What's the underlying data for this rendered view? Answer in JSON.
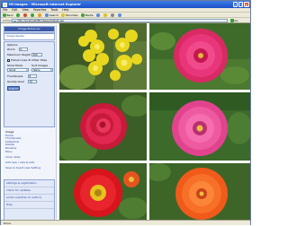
{
  "window": {
    "title": "IM Images - Microsoft Internet Explorer"
  },
  "menubar": {
    "items": [
      "File",
      "Edit",
      "View",
      "Favorites",
      "Tools",
      "Help"
    ]
  },
  "toolbar": {
    "items": [
      {
        "label": "Back",
        "icon": "back-icon",
        "color": "#3aa33a"
      },
      {
        "label": "",
        "icon": "forward-icon",
        "color": "#3aa33a"
      },
      {
        "label": "",
        "icon": "stop-icon",
        "color": "#d9492c"
      },
      {
        "label": "",
        "icon": "refresh-icon",
        "color": "#3aa33a"
      },
      {
        "label": "",
        "icon": "home-icon",
        "color": "#e0a020"
      },
      {
        "label": "Search",
        "icon": "search-icon",
        "color": "#5b8bd8"
      },
      {
        "label": "Favorites",
        "icon": "favorites-icon",
        "color": "#e0c020"
      },
      {
        "label": "Media",
        "icon": "media-icon",
        "color": "#3aa33a"
      },
      {
        "label": "",
        "icon": "history-icon",
        "color": "#5b8bd8"
      },
      {
        "label": "",
        "icon": "mail-icon",
        "color": "#e0c020"
      },
      {
        "label": "",
        "icon": "print-icon",
        "color": "#888888"
      },
      {
        "label": "",
        "icon": "edit-icon",
        "color": "#5b8bd8"
      }
    ],
    "links": [
      "Free Hotmail",
      "Free Smileys",
      "Customize Links",
      "Windows",
      "Bonus Websites in the Vista Rec",
      "Free Hotmail",
      "Free Template Image",
      "Free Stuff"
    ]
  },
  "address": {
    "label": "Address",
    "value": "http://localhost/IMimages/default.asp",
    "go_label": "Go"
  },
  "sidebar": {
    "header": "Image Enhancer",
    "top_text": [
      "Image Resize",
      "Options"
    ],
    "fields": {
      "zoom_label": "Zoom",
      "zoom_value": "0",
      "max_height_label": "Maximum Height",
      "max_height_value": "300",
      "follow_ratio_label": "Follow Lines To Other Sites",
      "show_label": "Show Mode",
      "show_value": "Small",
      "sort_label": "Sort Images",
      "sort_value": "Name",
      "thumbnails_label": "Thumbnails",
      "thumbnails_value": "8",
      "quality_label": "Quality level",
      "quality_value": "70",
      "submit_label": "Submit"
    },
    "nav_title": "Image",
    "nav_items": [
      "Home",
      "Thumbnails",
      "Slideshow",
      "Delete",
      "Rename",
      "More"
    ],
    "nav_extra": [
      "more news",
      "add new / new & edit",
      "Save & Insert new Setting"
    ],
    "bottom_items": [
      "settings & registration",
      "check for updates",
      "email us(admin to author)",
      "Help"
    ]
  },
  "gallery": {
    "items": [
      {
        "name": "yellow-snapdragon",
        "label": "yellow snapdragon flowers"
      },
      {
        "name": "pink-zinnia",
        "label": "pink zinnia"
      },
      {
        "name": "red-rose",
        "label": "red rose"
      },
      {
        "name": "magenta-zinnia",
        "label": "magenta zinnia"
      },
      {
        "name": "red-zinnia",
        "label": "red zinnia"
      },
      {
        "name": "orange-zinnia",
        "label": "orange zinnia"
      }
    ]
  },
  "status": {
    "text": "Done"
  }
}
